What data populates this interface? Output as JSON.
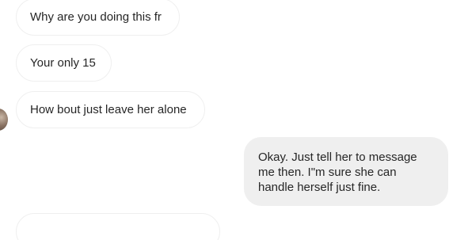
{
  "thread": {
    "incoming": [
      {
        "text": "Why are you doing this fr"
      },
      {
        "text": "Your only 15"
      },
      {
        "text": "How bout just leave her alone"
      },
      {
        "text": ""
      }
    ],
    "outgoing": [
      {
        "lines": [
          "Okay. Just tell her to message",
          "me then. I\"m sure she can",
          "handle herself just fine."
        ]
      }
    ]
  }
}
